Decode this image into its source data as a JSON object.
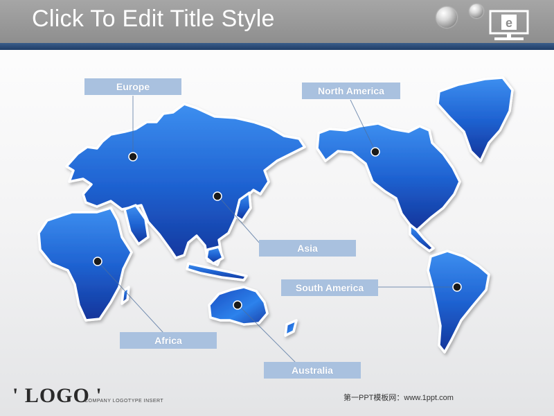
{
  "slide": {
    "title": "Click To Edit Title Style",
    "header_color": "#999999",
    "stripe_color": "#2b4b77",
    "accent_color": "#1f5fc9"
  },
  "labels": {
    "europe": "Europe",
    "north_america": "North America",
    "asia": "Asia",
    "south_america": "South America",
    "africa": "Africa",
    "australia": "Australia"
  },
  "monitor": {
    "glyph": "e",
    "icon": "monitor-icon"
  },
  "footer": {
    "logo": "' LOGO '",
    "logo_subtext": "COMPANY LOGOTYPE INSERT",
    "credit": "第一PPT模板网：www.1ppt.com"
  }
}
